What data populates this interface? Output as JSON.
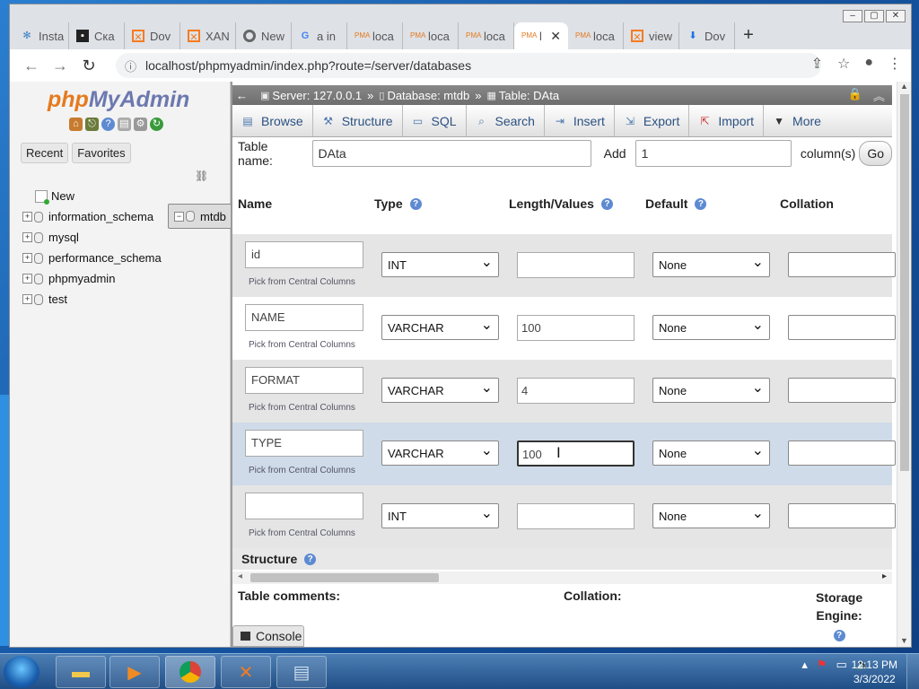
{
  "browser": {
    "tabs": [
      {
        "label": "Insta",
        "icon": "pinwheel-icon"
      },
      {
        "label": "Ска",
        "icon": "terminal-icon"
      },
      {
        "label": "Dov",
        "icon": "xampp-icon"
      },
      {
        "label": "XAN",
        "icon": "xampp-icon"
      },
      {
        "label": "New",
        "icon": "chrome-icon"
      },
      {
        "label": "a in",
        "icon": "google-icon"
      },
      {
        "label": "loca",
        "icon": "pma-icon"
      },
      {
        "label": "loca",
        "icon": "pma-icon"
      },
      {
        "label": "loca",
        "icon": "pma-icon"
      },
      {
        "label": "l",
        "icon": "pma-icon",
        "active": true
      },
      {
        "label": "loca",
        "icon": "pma-icon"
      },
      {
        "label": "view",
        "icon": "xampp-icon"
      },
      {
        "label": "Dov",
        "icon": "download-icon"
      }
    ],
    "url": "localhost/phpmyadmin/index.php?route=/server/databases"
  },
  "nav": {
    "logo_php": "php",
    "logo_myadmin": "MyAdmin",
    "tabs": [
      "Recent",
      "Favorites"
    ],
    "tree": [
      {
        "label": "New",
        "type": "new"
      },
      {
        "label": "information_schema",
        "type": "db"
      },
      {
        "label": "mtdb",
        "type": "db",
        "selected": true
      },
      {
        "label": "mysql",
        "type": "db"
      },
      {
        "label": "performance_schema",
        "type": "db"
      },
      {
        "label": "phpmyadmin",
        "type": "db"
      },
      {
        "label": "test",
        "type": "db"
      }
    ]
  },
  "breadcrumb": {
    "server": "Server: 127.0.0.1",
    "database": "Database: mtdb",
    "table": "Table: DAta",
    "sep": "»"
  },
  "menu": [
    "Browse",
    "Structure",
    "SQL",
    "Search",
    "Insert",
    "Export",
    "Import",
    "More"
  ],
  "form": {
    "table_name_label": "Table name:",
    "table_name_value": "DAta",
    "add_label": "Add",
    "add_value": "1",
    "columns_label": "column(s)",
    "go_label": "Go"
  },
  "columns_header": {
    "name": "Name",
    "type": "Type",
    "length": "Length/Values",
    "default": "Default",
    "collation": "Collation"
  },
  "pick_label": "Pick from Central Columns",
  "rows": [
    {
      "name": "id",
      "type": "INT",
      "length": "",
      "default": "None"
    },
    {
      "name": "NAME",
      "type": "VARCHAR",
      "length": "100",
      "default": "None"
    },
    {
      "name": "FORMAT",
      "type": "VARCHAR",
      "length": "4",
      "default": "None"
    },
    {
      "name": "TYPE",
      "type": "VARCHAR",
      "length": "100",
      "default": "None"
    },
    {
      "name": "",
      "type": "INT",
      "length": "",
      "default": "None"
    }
  ],
  "structure_label": "Structure",
  "bottom": {
    "table_comments": "Table comments:",
    "collation": "Collation:",
    "storage_engine_1": "Storage",
    "storage_engine_2": "Engine:"
  },
  "console_label": "Console",
  "taskbar": {
    "time": "12:13 PM",
    "date": "3/3/2022"
  }
}
